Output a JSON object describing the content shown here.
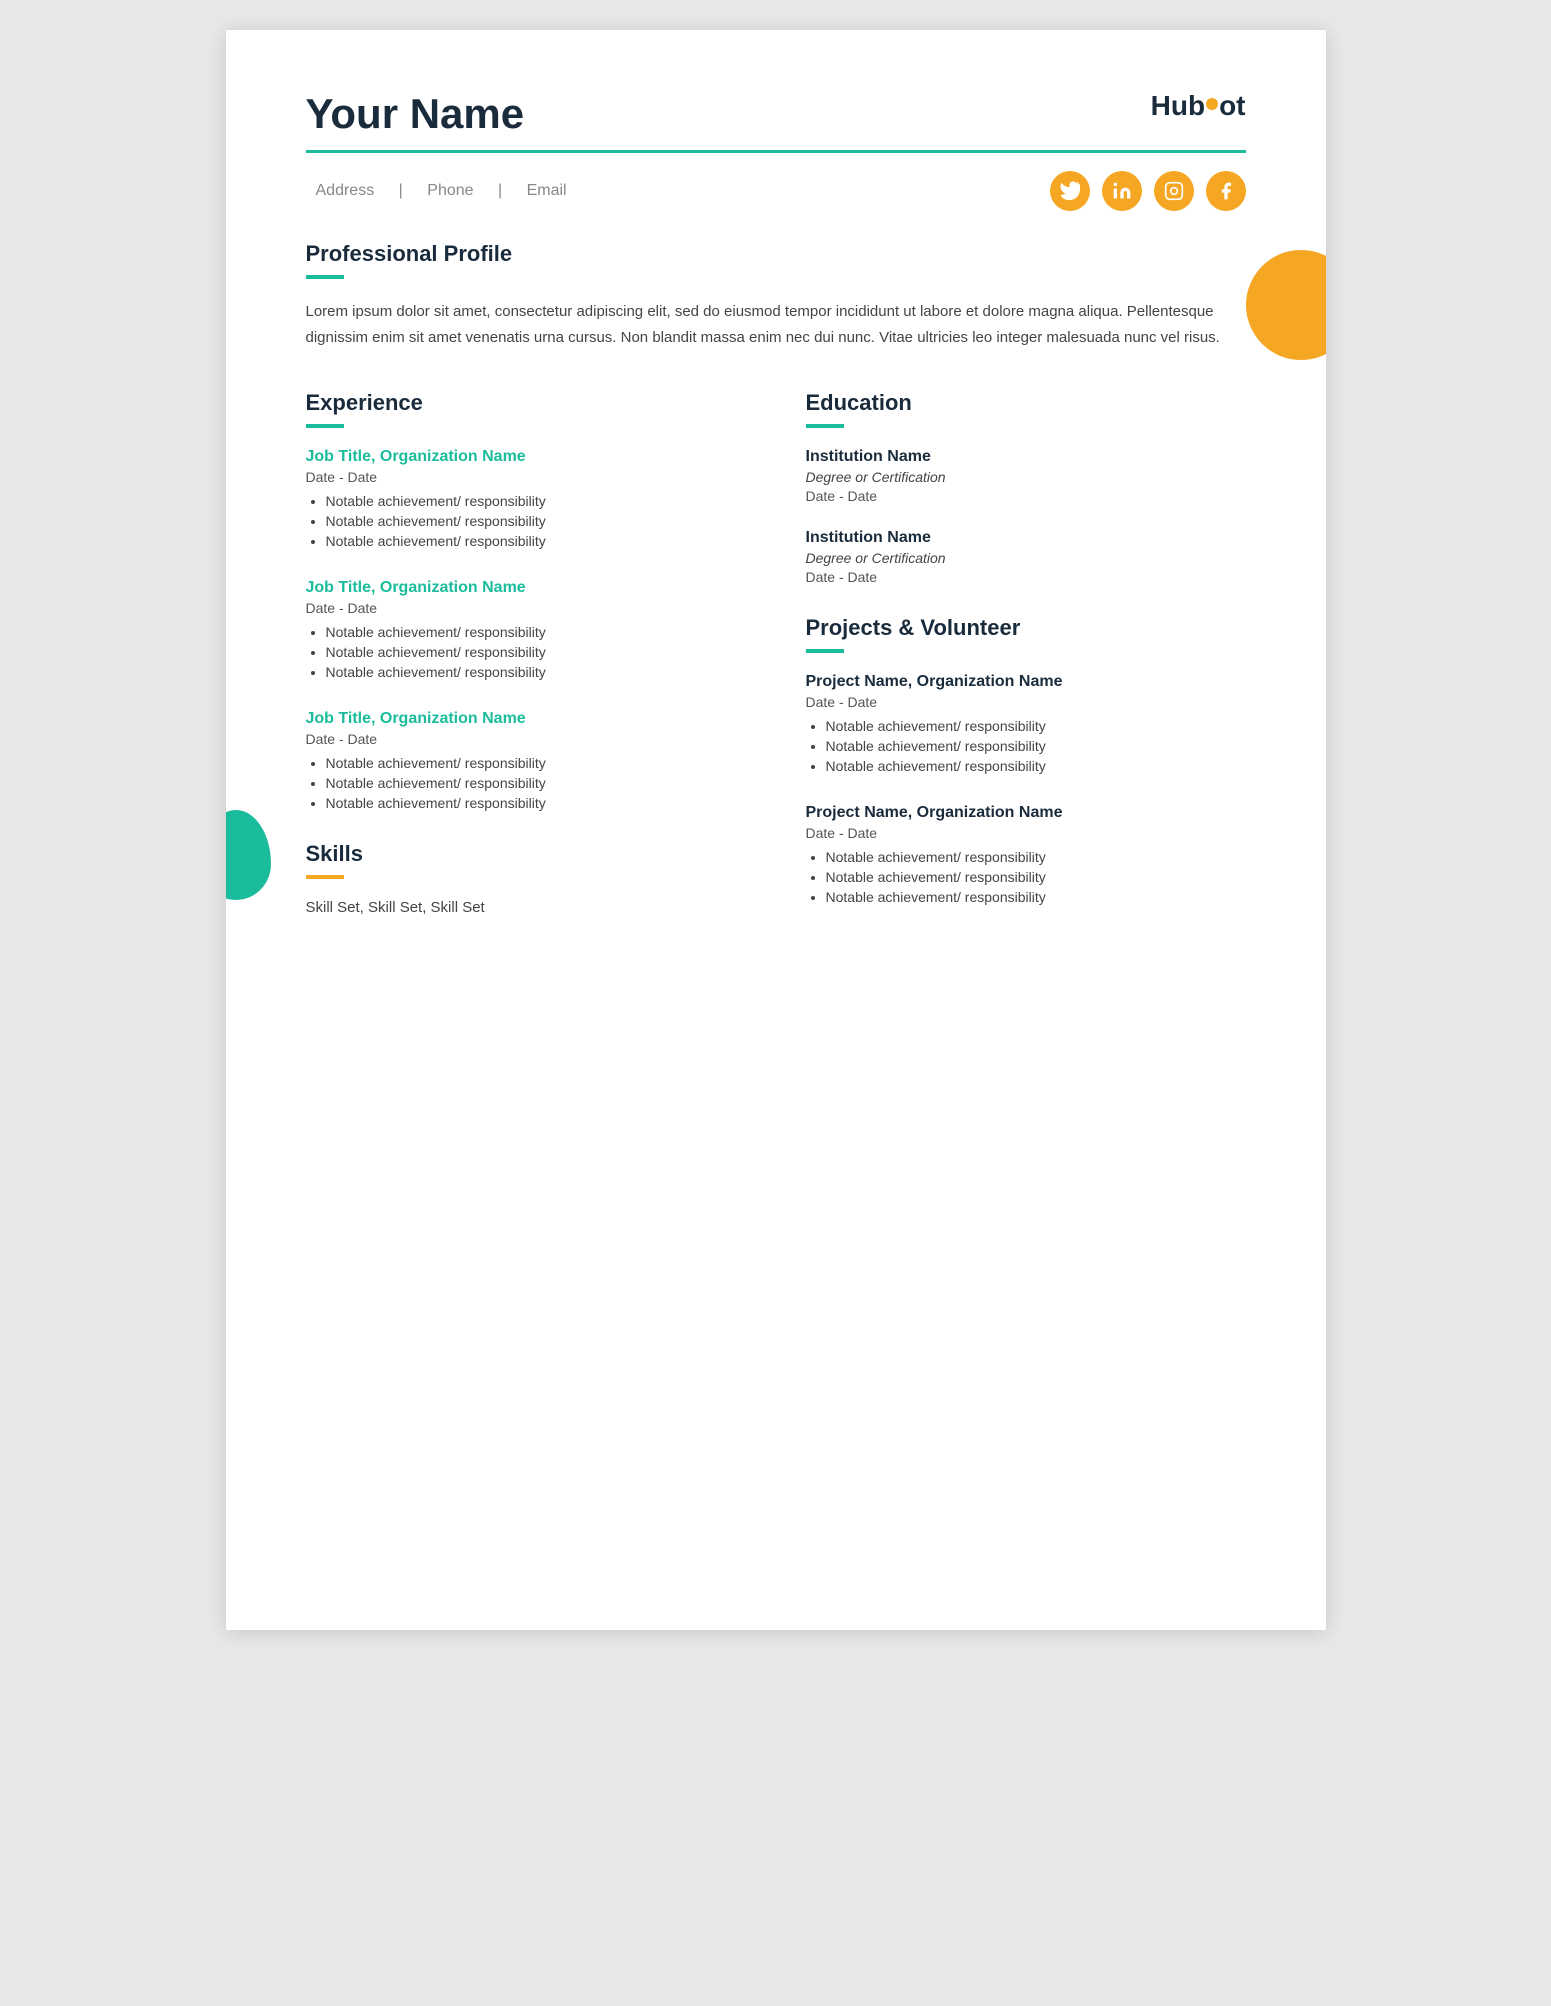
{
  "header": {
    "name": "Your Name",
    "logo_text_1": "Hub",
    "logo_text_2": "ot",
    "divider": true
  },
  "contact": {
    "address": "Address",
    "separator1": "|",
    "phone": "Phone",
    "separator2": "|",
    "email": "Email"
  },
  "social": {
    "icons": [
      "twitter",
      "linkedin",
      "instagram",
      "facebook"
    ]
  },
  "profile": {
    "section_title": "Professional Profile",
    "body": "Lorem ipsum dolor sit amet, consectetur adipiscing elit, sed do eiusmod tempor incididunt ut labore et dolore magna aliqua. Pellentesque dignissim enim sit amet venenatis urna cursus. Non blandit massa enim nec dui nunc. Vitae ultricies leo integer malesuada nunc vel risus."
  },
  "experience": {
    "section_title": "Experience",
    "jobs": [
      {
        "title": "Job Title, Organization Name",
        "date": "Date - Date",
        "bullets": [
          "Notable achievement/ responsibility",
          "Notable achievement/ responsibility",
          "Notable achievement/ responsibility"
        ]
      },
      {
        "title": "Job Title, Organization Name",
        "date": "Date - Date",
        "bullets": [
          "Notable achievement/ responsibility",
          "Notable achievement/ responsibility",
          "Notable achievement/ responsibility"
        ]
      },
      {
        "title": "Job Title, Organization Name",
        "date": "Date - Date",
        "bullets": [
          "Notable achievement/ responsibility",
          "Notable achievement/ responsibility",
          "Notable achievement/ responsibility"
        ]
      }
    ]
  },
  "skills": {
    "section_title": "Skills",
    "content": "Skill Set, Skill Set, Skill Set"
  },
  "education": {
    "section_title": "Education",
    "entries": [
      {
        "institution": "Institution Name",
        "degree": "Degree or Certification",
        "date": "Date - Date"
      },
      {
        "institution": "Institution Name",
        "degree": "Degree or Certification",
        "date": "Date - Date"
      }
    ]
  },
  "projects": {
    "section_title": "Projects & Volunteer",
    "entries": [
      {
        "title": "Project Name, Organization Name",
        "date": "Date - Date",
        "bullets": [
          "Notable achievement/ responsibility",
          "Notable achievement/ responsibility",
          "Notable achievement/ responsibility"
        ]
      },
      {
        "title": "Project Name, Organization Name",
        "date": "Date - Date",
        "bullets": [
          "Notable achievement/ responsibility",
          "Notable achievement/ responsibility",
          "Notable achievement/ responsibility"
        ]
      }
    ]
  }
}
